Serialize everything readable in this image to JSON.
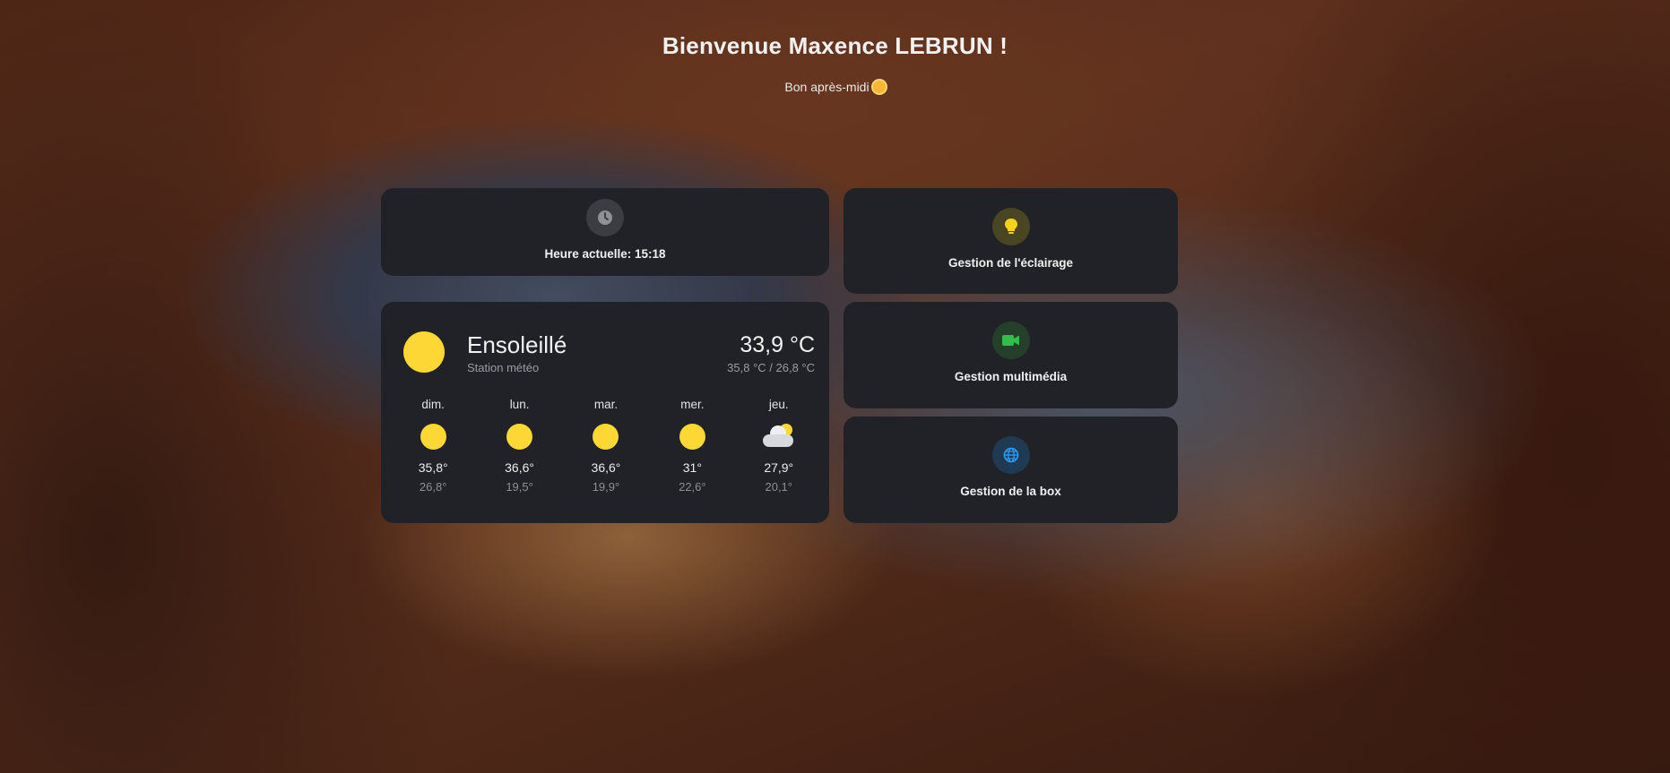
{
  "header": {
    "title": "Bienvenue Maxence LEBRUN !",
    "greeting": "Bon après-midi"
  },
  "clock": {
    "icon": "clock-icon",
    "label": "Heure actuelle: 15:18"
  },
  "weather": {
    "condition": "Ensoleillé",
    "station": "Station météo",
    "temperature": "33,9 °C",
    "range": "35,8 °C / 26,8 °C",
    "forecast": [
      {
        "day": "dim.",
        "icon": "sun-icon",
        "high": "35,8°",
        "low": "26,8°"
      },
      {
        "day": "lun.",
        "icon": "sun-icon",
        "high": "36,6°",
        "low": "19,5°"
      },
      {
        "day": "mar.",
        "icon": "sun-icon",
        "high": "36,6°",
        "low": "19,9°"
      },
      {
        "day": "mer.",
        "icon": "sun-icon",
        "high": "31°",
        "low": "22,6°"
      },
      {
        "day": "jeu.",
        "icon": "partly-cloudy-icon",
        "high": "27,9°",
        "low": "20,1°"
      }
    ]
  },
  "tiles": {
    "lighting": {
      "label": "Gestion de l'éclairage",
      "icon": "lightbulb-icon",
      "color": "#f7d21b"
    },
    "media": {
      "label": "Gestion multimédia",
      "icon": "video-camera-icon",
      "color": "#2fbf4a"
    },
    "box": {
      "label": "Gestion de la box",
      "icon": "globe-icon",
      "color": "#2b9bf4"
    }
  },
  "colors": {
    "card_bg": "#202228",
    "sun": "#fdd835"
  }
}
